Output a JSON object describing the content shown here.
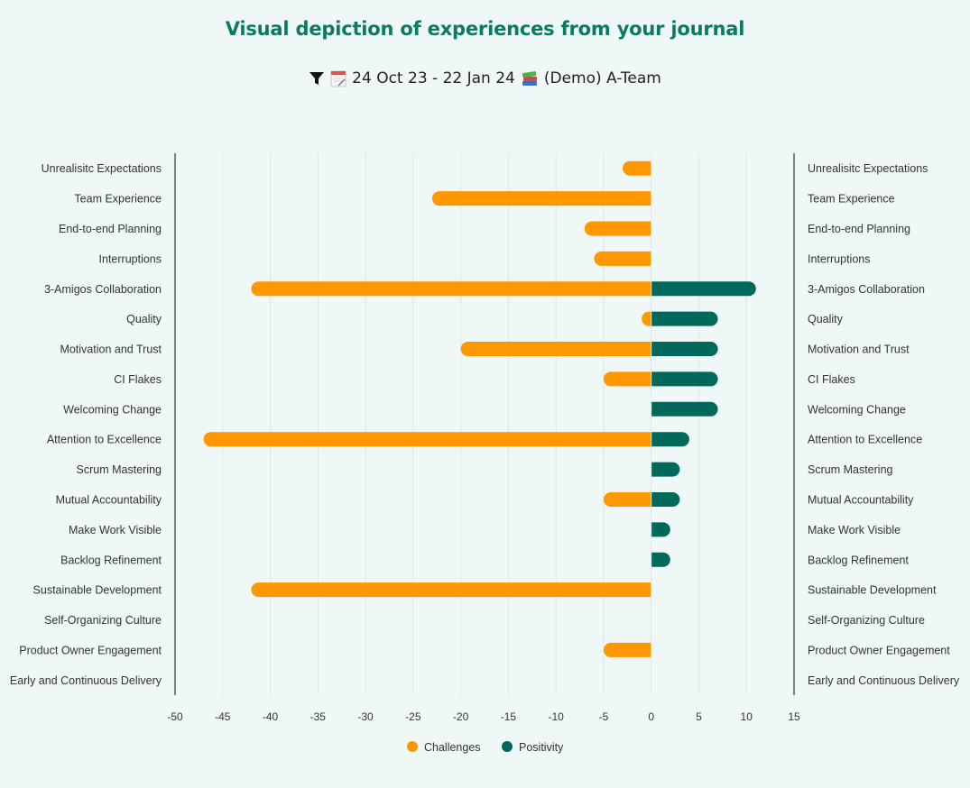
{
  "header": {
    "title": "Visual depiction of experiences from your journal",
    "filter_icon": "funnel-icon",
    "calendar_icon": "calendar-icon",
    "date_range": "24 Oct 23 - 22 Jan 24",
    "team_icon": "books-icon",
    "team": "(Demo) A-Team"
  },
  "colors": {
    "challenges": "#ff9800",
    "positivity": "#00695c",
    "title": "#0b7a63",
    "background": "#eff8f6"
  },
  "chart_data": {
    "type": "bar",
    "orientation": "horizontal",
    "stacked": true,
    "title": "Visual depiction of experiences from your journal",
    "xlabel": "",
    "ylabel": "",
    "xlim": [
      -50,
      15
    ],
    "xticks": [
      -50,
      -45,
      -40,
      -35,
      -30,
      -25,
      -20,
      -15,
      -10,
      -5,
      0,
      5,
      10,
      15
    ],
    "grid": true,
    "legend": "bottom-center",
    "categories": [
      "Unrealisitc Expectations",
      "Team Experience",
      "End-to-end Planning",
      "Interruptions",
      "3-Amigos Collaboration",
      "Quality",
      "Motivation and Trust",
      "CI Flakes",
      "Welcoming Change",
      "Attention to Excellence",
      "Scrum Mastering",
      "Mutual Accountability",
      "Make Work Visible",
      "Backlog Refinement",
      "Sustainable Development",
      "Self-Organizing Culture",
      "Product Owner Engagement",
      "Early and Continuous Delivery"
    ],
    "series": [
      {
        "name": "Challenges",
        "color": "#ff9800",
        "values": [
          -3,
          -23,
          -7,
          -6,
          -42,
          -1,
          -20,
          -5,
          0,
          -47,
          0,
          -5,
          0,
          0,
          -42,
          0,
          -5,
          0
        ]
      },
      {
        "name": "Positivity",
        "color": "#00695c",
        "values": [
          0,
          0,
          0,
          0,
          11,
          7,
          7,
          7,
          7,
          4,
          3,
          3,
          2,
          2,
          0,
          0,
          0,
          0
        ]
      }
    ]
  }
}
